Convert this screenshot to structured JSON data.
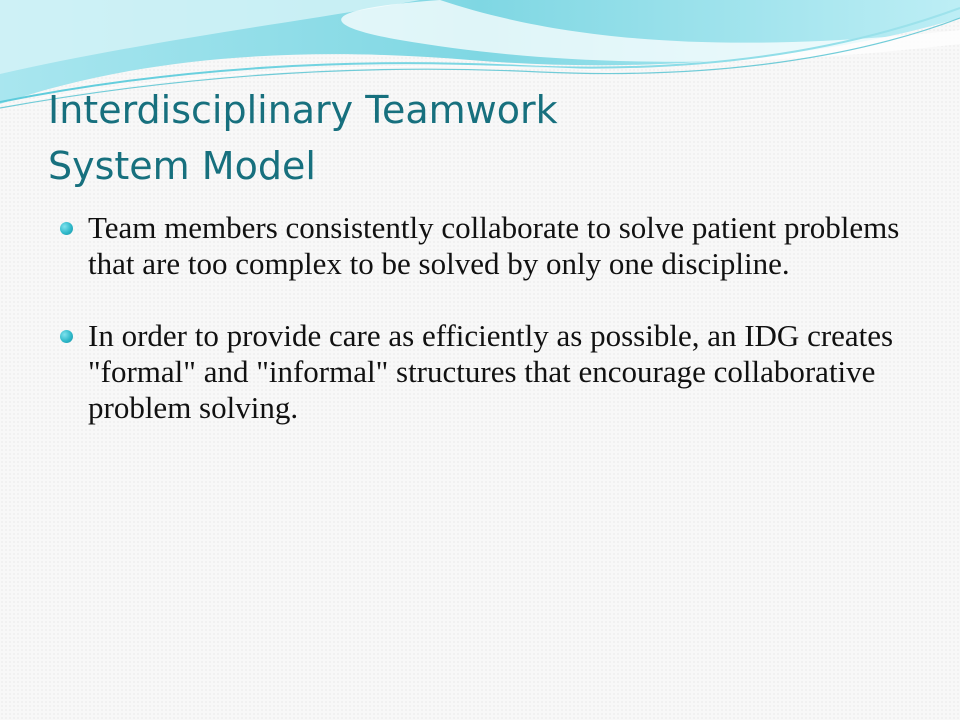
{
  "slide": {
    "title_lines": [
      "Interdisciplinary Teamwork",
      "System Model"
    ],
    "bullets": [
      {
        "icon": "bullet-dot-icon",
        "text": "Team members consistently collaborate to solve patient problems that are too complex to be solved by only one discipline."
      },
      {
        "icon": "bullet-dot-icon",
        "text": "In order to provide care as efficiently as possible, an IDG creates \"formal\" and \"informal\" structures that encourage collaborative problem solving."
      }
    ]
  },
  "colors": {
    "title": "#17707e",
    "accent": "#2fb8c9",
    "wave_light": "#bfeef4",
    "wave_mid": "#6fd3e0",
    "body_text": "#111111"
  }
}
